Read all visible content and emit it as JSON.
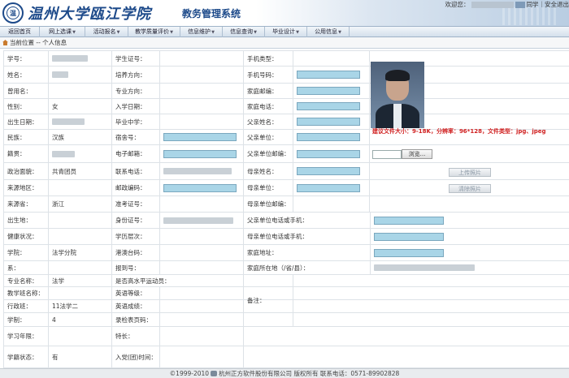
{
  "header": {
    "logo_text": "温",
    "school_name": "温州大学瓯江学院",
    "system_name": "教务管理系统",
    "welcome_prefix": "欢迎您：",
    "welcome_suffix": "同学",
    "exit_label": "安全退出"
  },
  "nav": [
    {
      "label": "返回首页",
      "arrow": ""
    },
    {
      "label": "网上选课",
      "arrow": "▼"
    },
    {
      "label": "活动报名",
      "arrow": "▼"
    },
    {
      "label": "教学质量评价",
      "arrow": "▼"
    },
    {
      "label": "信息维护",
      "arrow": "▼"
    },
    {
      "label": "信息查询",
      "arrow": "▼"
    },
    {
      "label": "毕业设计",
      "arrow": "▼"
    },
    {
      "label": "公用信息",
      "arrow": "▼"
    }
  ],
  "breadcrumb": {
    "prefix": "当前位置",
    "path": " -- 个人信息"
  },
  "form": {
    "xuehao": "学号：",
    "xingming": "姓名：",
    "cengyongming": "曾用名：",
    "xingbie": "性别：",
    "xingbie_val": "女",
    "chusheng": "出生日期：",
    "minzu": "民族：",
    "minzu_val": "汉族",
    "jiguan": "籍贯：",
    "zhengzhi": "政治面貌：",
    "zhengzhi_val": "共青团员",
    "laiyuan_diqu": "来源地区：",
    "laiyuan_sheng": "来源省：",
    "laiyuan_sheng_val": "浙江",
    "chushengdi": "出生地：",
    "jiankang": "健康状况：",
    "xueyuan": "学院：",
    "xueyuan_val": "法学分院",
    "xi": "系：",
    "zhuanye": "专业名称：",
    "zhuanye_val": "法学",
    "jiaoxueban": "教学班名称：",
    "xingzhengban": "行政班：",
    "xingzhengban_val": "11法学二",
    "xuezhi": "学制：",
    "xuezhi_val": "4",
    "xuexinianxian": "学习年限：",
    "xuejizhuangtai": "学籍状态：",
    "xuejizhuangtai_val": "有",
    "xueshengzheng": "学生证号：",
    "zhuanyefangxiang1": "培养方向：",
    "zhuanyefangxiang2": "专业方向：",
    "ruxueriqi": "入学日期：",
    "biyezhongxue": "毕业中学：",
    "sushehao": "宿舍号：",
    "dianziyouxiang": "电子邮箱：",
    "lianxidianhua": "联系电话：",
    "youzhengbianma": "邮政编码：",
    "zhunkaozheng": "准考证号：",
    "shenfenzheng": "身份证号：",
    "xuelicengci": "学历层次：",
    "gangaotai": "港澳台码：",
    "baodaohao": "报到号：",
    "shifougaoshuiping": "是否高水平运动员：",
    "yingyudengji": "英语等级：",
    "yingyuchengji": "英语成绩：",
    "luqu": "录检表页码：",
    "techang": "特长：",
    "rudang": "入党(团)时间：",
    "shoujileixing": "手机类型：",
    "shoujihaoma": "手机号码：",
    "jiatingyoubian": "家庭邮编：",
    "jiatingdianhua": "家庭电话：",
    "fuqinxingming": "父亲姓名：",
    "fuqindanwei": "父亲单位：",
    "fuqindanweiyoubian": "父亲单位邮编：",
    "muqinxingming": "母亲姓名：",
    "muqindanwei": "母亲单位：",
    "muqindanweiyoubian": "母亲单位邮编：",
    "fuqindianhua": "父亲单位电话或手机：",
    "muqindianhua": "母亲单位电话或手机：",
    "jiatingdizhi": "家庭地址：",
    "jiatingsuozaidi": "家庭所在地（/省/县）：",
    "beizhu": "备注："
  },
  "photo": {
    "note": "建议文件大小：9-18K，分辨率：96*128，文件类型：jpg、jpeg",
    "browse_label": "浏览...",
    "upload_label": "上传照片",
    "delete_label": "清除照片"
  },
  "footer": {
    "copyright": "©1999-2010",
    "company": "杭州正方软件股份有限公司",
    "rights": "版权所有",
    "phone": "联系电话：0571-89902828"
  }
}
